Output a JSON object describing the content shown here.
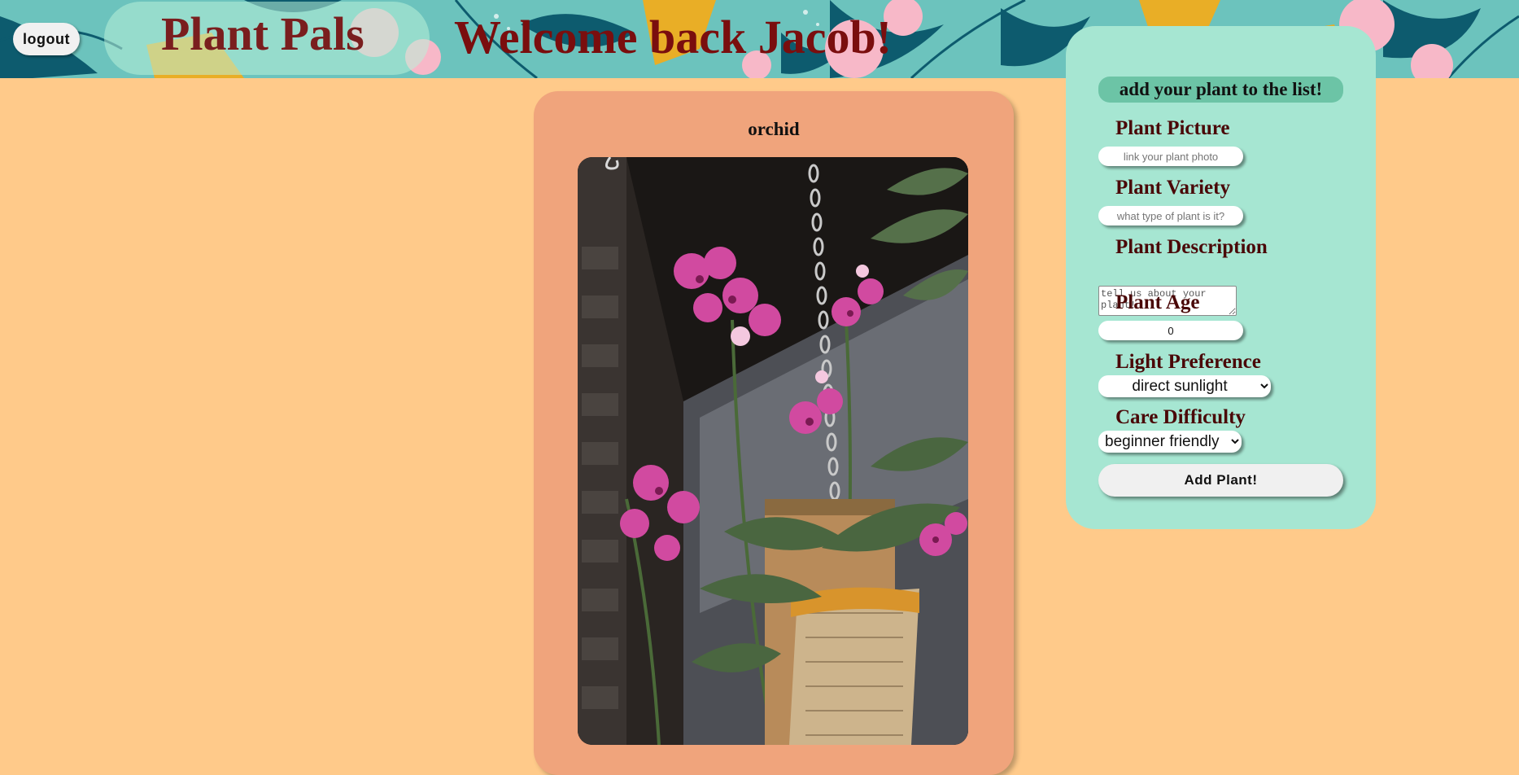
{
  "header": {
    "logout_label": "logout",
    "site_title": "Plant Pals",
    "welcome_text": "Welcome back Jacob!"
  },
  "plant_card": {
    "name": "orchid",
    "photo_alt": "orchid"
  },
  "add_form": {
    "heading": "add your plant to the list!",
    "picture": {
      "label": "Plant Picture",
      "placeholder": "link your plant photo"
    },
    "variety": {
      "label": "Plant Variety",
      "placeholder": "what type of plant is it?"
    },
    "description": {
      "label": "Plant Description",
      "placeholder": "tell us about your plant!"
    },
    "age": {
      "label": "Plant Age",
      "value": "0"
    },
    "light": {
      "label": "Light Preference",
      "selected": "direct sunlight"
    },
    "care": {
      "label": "Care Difficulty",
      "selected": "beginner friendly"
    },
    "submit_label": "Add Plant!"
  },
  "colors": {
    "page_bg": "#ffca8a",
    "card_bg": "#f0a47c",
    "form_bg": "#a6e6d2",
    "accent": "#6cc4a6",
    "title_color": "#7a1e1e",
    "label_color": "#4a0808"
  }
}
